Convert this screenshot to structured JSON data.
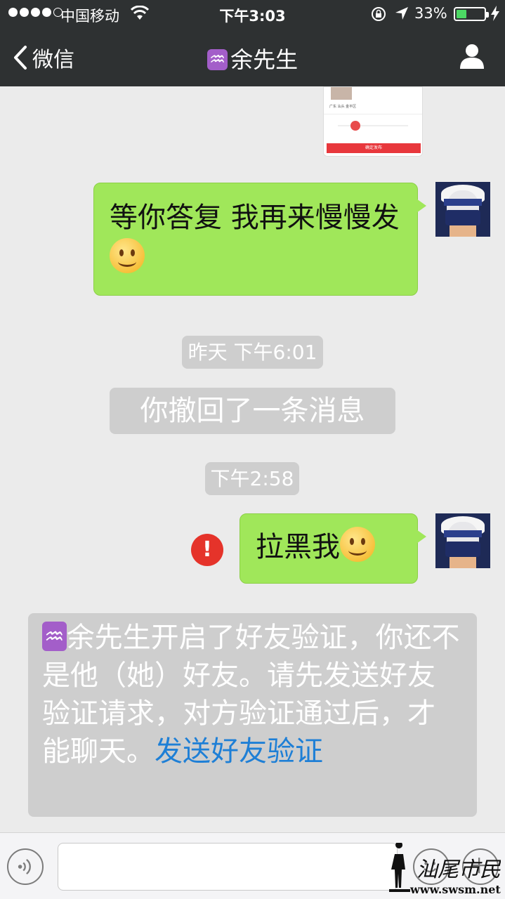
{
  "status_bar": {
    "carrier": "中国移动",
    "time": "下午3:03",
    "battery_percent": "33%",
    "signal_bars": 4,
    "icons": [
      "wifi-icon",
      "rotation-lock-icon",
      "location-icon",
      "battery-icon",
      "charging-bolt-icon"
    ]
  },
  "nav": {
    "back_label": "微信",
    "title_symbol": "♒",
    "title_name": "余先生"
  },
  "messages": {
    "m1_text": "等你答复 我再来慢慢发",
    "timestamp1": "昨天 下午6:01",
    "recall_notice": "你撤回了一条消息",
    "timestamp2": "下午2:58",
    "m2_text": "拉黑我",
    "error_mark": "!"
  },
  "system_notice": {
    "symbol": "♒",
    "text": "余先生开启了好友验证，你还不是他（她）好友。请先发送好友验证请求，对方验证通过后，才能聊天。",
    "link": "发送好友验证"
  },
  "screenshot_thumb": {
    "location_text": "广东 汕头 金平区",
    "button_text": "确定发布"
  },
  "watermark": {
    "text": "汕尾市民网",
    "url": "www.swsm.net"
  },
  "colors": {
    "nav_bg": "#2e3132",
    "chat_bg": "#ebebeb",
    "bubble_green": "#a0e75a",
    "error_red": "#e5332a",
    "link_blue": "#1e7fd6"
  }
}
